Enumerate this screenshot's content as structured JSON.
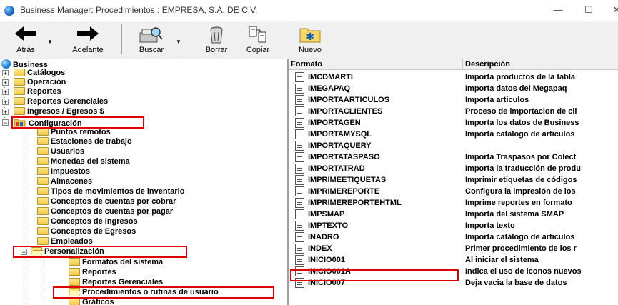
{
  "window": {
    "title": "Business Manager: Procedimientos : EMPRESA, S.A. DE C.V.",
    "minimize": "—",
    "maximize": "☐",
    "close": "✕"
  },
  "toolbar": {
    "back": "Atrás",
    "forward": "Adelante",
    "search": "Buscar",
    "delete": "Borrar",
    "copy": "Copiar",
    "new": "Nuevo"
  },
  "tree": {
    "root": "Business",
    "catalogos": "Catálogos",
    "operacion": "Operación",
    "reportes": "Reportes",
    "reportes_gerenciales": "Reportes Gerenciales",
    "ingresos": "Ingresos / Egresos $",
    "configuracion": "Configuración",
    "config_children": [
      "Puntos remotos",
      "Estaciones de trabajo",
      "Usuarios",
      "Monedas del sistema",
      "Impuestos",
      "Almacenes",
      "Tipos de movimientos de inventario",
      "Conceptos de cuentas por cobrar",
      "Conceptos de cuentas por pagar",
      "Conceptos de Ingresos",
      "Conceptos de Egresos",
      "Empleados"
    ],
    "personalizacion": "Personalización",
    "pers_children": [
      "Formatos del sistema",
      "Reportes",
      "Reportes Gerenciales",
      "Procedimientos o rutinas de usuario",
      "Gráficos"
    ]
  },
  "list": {
    "col_format": "Formato",
    "col_desc": "Descripción",
    "rows": [
      {
        "format": "IMCDMARTI",
        "desc": "Importa productos de la tabla"
      },
      {
        "format": "IMEGAPAQ",
        "desc": "Importa datos del Megapaq"
      },
      {
        "format": "IMPORTAARTICULOS",
        "desc": "Importa articulos"
      },
      {
        "format": "IMPORTACLIENTES",
        "desc": "Proceso de importacion de cli"
      },
      {
        "format": "IMPORTAGEN",
        "desc": "Importa los datos de Business"
      },
      {
        "format": "IMPORTAMYSQL",
        "desc": "Importa catalogo de articulos"
      },
      {
        "format": "IMPORTAQUERY",
        "desc": ""
      },
      {
        "format": "IMPORTATASPASO",
        "desc": "Importa Traspasos por Colect"
      },
      {
        "format": "IMPORTATRAD",
        "desc": "Importa la traducción de produ"
      },
      {
        "format": "IMPRIMEETIQUETAS",
        "desc": "Imprimir etiquetas de códigos"
      },
      {
        "format": "IMPRIMEREPORTE",
        "desc": "Configura la impresión de los"
      },
      {
        "format": "IMPRIMEREPORTEHTML",
        "desc": "Imprime reportes en formato"
      },
      {
        "format": "IMPSMAP",
        "desc": "Importa del sistema SMAP"
      },
      {
        "format": "IMPTEXTO",
        "desc": "Importa texto"
      },
      {
        "format": "INADRO",
        "desc": "Importa catálogo de articulos"
      },
      {
        "format": "INDEX",
        "desc": "Primer procedimiento de los r"
      },
      {
        "format": "INICIO001",
        "desc": "Al iniciar el sistema"
      },
      {
        "format": "INICIO001A",
        "desc": "Indica el uso de iconos nuevos"
      },
      {
        "format": "INICIO007",
        "desc": "Deja vacia la base de datos"
      }
    ]
  },
  "colors": {
    "highlight": "#e00000",
    "folder": "#f2c94c"
  }
}
